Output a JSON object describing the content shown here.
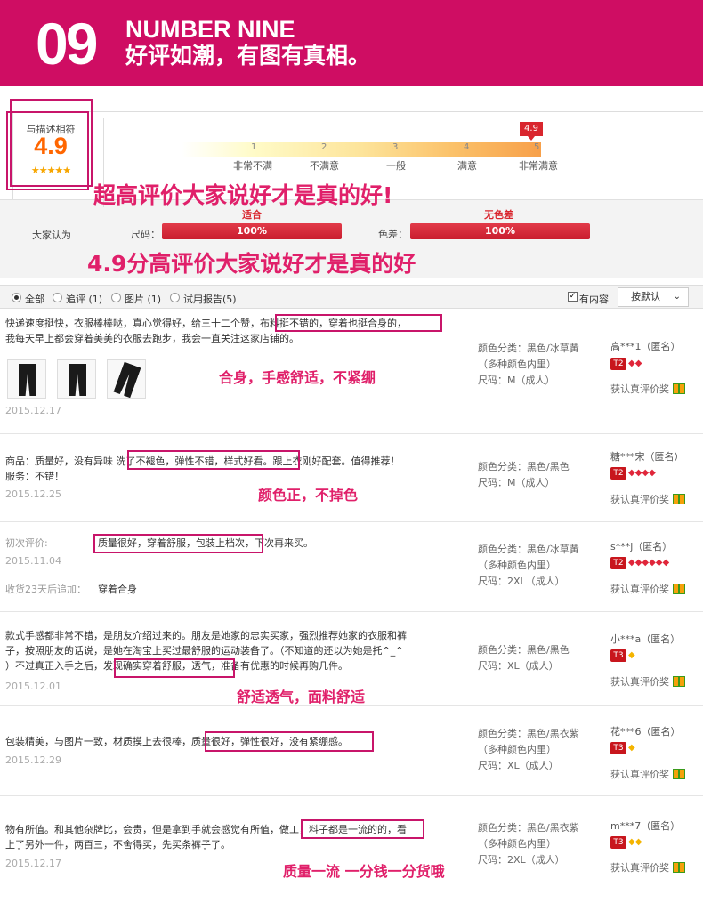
{
  "banner": {
    "number": "09",
    "title_en": "NUMBER NINE",
    "title_cn": "好评如潮，有图有真相。"
  },
  "rating": {
    "label": "与描述相符",
    "score": "4.9",
    "stars": "★★★★★",
    "flag": "4.9",
    "ticks": [
      "1",
      "2",
      "3",
      "4",
      "5"
    ],
    "tick_labels": [
      "非常不满",
      "不满意",
      "一般",
      "满意",
      "非常满意"
    ],
    "slogan1": "超高评价大家说好才是真的好!",
    "slogan2": "4.9分高评价大家说好才是真的好",
    "public_label": "大家认为",
    "size_label": "尺码：",
    "size_title": "适合",
    "size_value": "100%",
    "size_percent": 100,
    "color_label": "色差：",
    "color_title": "无色差",
    "color_value": "100%",
    "color_percent": 100
  },
  "filters": {
    "all": "全部",
    "append": "追评 (1)",
    "pics": "图片 (1)",
    "trial": "试用报告(5)",
    "has_content": "有内容",
    "sort": "按默认"
  },
  "reviews": [
    {
      "line1": "快递速度挺快，衣服棒棒哒，真心觉得好，给三十二个赞，",
      "hl": "布料挺不错的，穿着也挺合身的，",
      "line2": "我每天早上都会穿着美美的衣服去跑步，我会一直关注这家店铺的。",
      "date": "2015.12.17",
      "note": "合身，手感舒适，不紧绷",
      "attr1": "颜色分类：黑色/冰草黄",
      "attr2": "（多种颜色内里）",
      "attr3": "尺码：M（成人）",
      "user": "高***1（匿名）",
      "badge": "T2",
      "gems": "◆◆",
      "gift": "获认真评价奖"
    },
    {
      "line1a": "商品：质量好，没有异味",
      "hl": "洗了不褪色，弹性不错，样式好看。",
      "line1b": "跟上衣刚好配套。值得推荐！",
      "line2": "服务：不错！",
      "date": "2015.12.25",
      "note": "颜色正，不掉色",
      "attr1": "颜色分类：黑色/黑色",
      "attr3": "尺码：M（成人）",
      "user": "糖***宋（匿名）",
      "badge": "T2",
      "gems": "◆◆◆◆",
      "gift": "获认真评价奖"
    },
    {
      "first_label": "初次评价:",
      "hl": "质量很好，穿着舒服，包装上档次",
      "line1b": "，下次再来买。",
      "date": "2015.11.04",
      "append_label": "收货23天后追加：",
      "append_text": "穿着合身",
      "attr1": "颜色分类：黑色/冰草黄",
      "attr2": "（多种颜色内里）",
      "attr3": "尺码：2XL（成人）",
      "user": "s***j（匿名）",
      "badge": "T2",
      "gems": "◆◆◆◆◆◆",
      "gift": "获认真评价奖"
    },
    {
      "line1": "款式手感都非常不错，是朋友介绍过来的。朋友是她家的忠实买家，强烈推荐她家的衣服和裤",
      "line2": "子，按照朋友的话说，是她在淘宝上买过最舒服的运动装备了。（不知道的还以为她是托^_^",
      "line3a": "）不过真正入手之后，",
      "hl": "发现确实穿着舒服，透气",
      "line3b": "，准备有优惠的时候再购几件。",
      "date": "2015.12.01",
      "note": "舒适透气，面料舒适",
      "attr1": "颜色分类：黑色/黑色",
      "attr3": "尺码：XL（成人）",
      "user": "小***a（匿名）",
      "badge": "T3",
      "gems": "◆",
      "gift": "获认真评价奖"
    },
    {
      "line1a": "包装精美，与图片一致，材质摸上去很棒，",
      "hl": "质量很好，弹性很好，没有紧绷感。",
      "date": "2015.12.29",
      "attr1": "颜色分类：黑色/黑衣紫",
      "attr2": "（多种颜色内里）",
      "attr3": "尺码：XL（成人）",
      "user": "花***6（匿名）",
      "badge": "T3",
      "gems": "◆",
      "gift": "获认真评价奖"
    },
    {
      "line1a": "物有所值。和其他杂牌比，会贵，但是拿到手就会感觉有所值，",
      "hl": "做工，料子都是一流的的",
      "line1b": "，看",
      "line2": "上了另外一件，两百三，不舍得买，先买条裤子了。",
      "date": "2015.12.17",
      "note": "质量一流 一分钱一分货哦",
      "attr1": "颜色分类：黑色/黑衣紫",
      "attr2": "（多种颜色内里）",
      "attr3": "尺码：2XL（成人）",
      "user": "m***7（匿名）",
      "badge": "T3",
      "gems": "◆◆",
      "gift": "获认真评价奖"
    }
  ],
  "colors": {
    "brand": "#cf0d63",
    "highlight": "#c8156a",
    "note": "#e0206a",
    "bar": "#c91d2e"
  }
}
